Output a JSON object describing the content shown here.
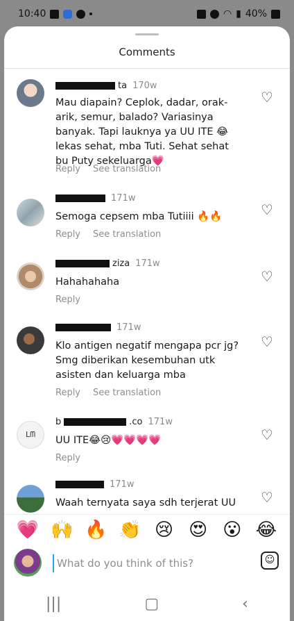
{
  "status": {
    "time": "10:40",
    "battery": "40%"
  },
  "sheet": {
    "title": "Comments"
  },
  "comments": [
    {
      "time": "170w",
      "text": "Mau diapain? Ceplok, dadar, orak-arik, semur, balado? Variasinya banyak. Tapi lauknya ya UU ITE 😂 lekas sehat, mba Tuti. Sehat sehat bu Puty sekeluarga💗",
      "suffix": "ta",
      "reply": "Reply",
      "translate": "See translation"
    },
    {
      "time": "171w",
      "text": "Semoga cepsem mba Tutiiii 🔥🔥",
      "suffix": "",
      "reply": "Reply",
      "translate": "See translation"
    },
    {
      "time": "171w",
      "text": "Hahahahaha",
      "suffix": "ziza",
      "reply": "Reply",
      "translate": ""
    },
    {
      "time": "171w",
      "text": "Klo antigen negatif mengapa pcr jg? Smg diberikan kesembuhan utk asisten dan keluarga mba",
      "suffix": "",
      "reply": "Reply",
      "translate": "See translation"
    },
    {
      "time": "171w",
      "text": "UU ITE😂😢💗💗💗💗",
      "prefix": "b",
      "suffix": ".co",
      "reply": "Reply",
      "translate": ""
    },
    {
      "time": "171w",
      "text": "Waah ternyata saya sdh terjerat UU",
      "suffix": "",
      "reply": "",
      "translate": ""
    }
  ],
  "emoji_bar": [
    "💗",
    "🙌",
    "🔥",
    "👏",
    "😢",
    "😍",
    "😮",
    "😂"
  ],
  "input": {
    "placeholder": "What do you think of this?"
  }
}
